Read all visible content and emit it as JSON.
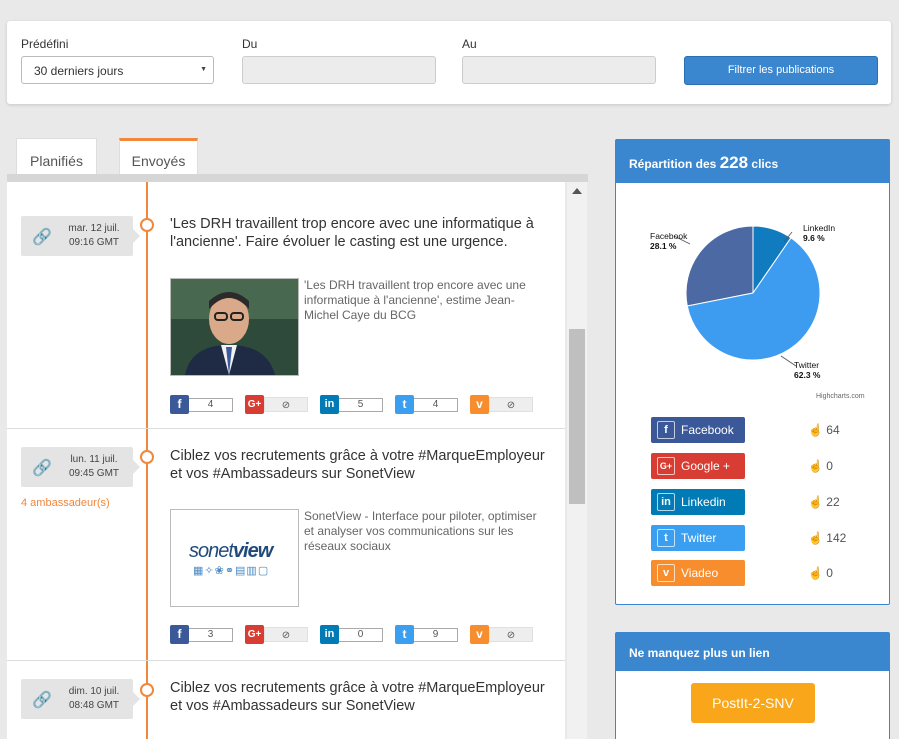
{
  "filter": {
    "predefini_label": "Prédéfini",
    "predefini_value": "30 derniers jours",
    "du_label": "Du",
    "au_label": "Au",
    "button_label": "Filtrer les publications"
  },
  "tabs": [
    {
      "label": "Planifiés",
      "active": false
    },
    {
      "label": "Envoyés",
      "active": true
    }
  ],
  "posts": [
    {
      "date": "mar. 12 juil.",
      "time": "09:16 GMT",
      "title": "'Les DRH travaillent trop encore avec une informatique à l'ancienne'. Faire évoluer le casting est une urgence.",
      "desc": "'Les DRH travaillent trop encore avec une informatique à l'ancienne', estime Jean-Michel Caye du BCG",
      "counts": {
        "facebook": "4",
        "google": "⊘",
        "linkedin": "5",
        "twitter": "4",
        "viadeo": "⊘"
      }
    },
    {
      "date": "lun. 11 juil.",
      "time": "09:45 GMT",
      "ambassadeurs": "4 ambassadeur(s)",
      "title": "Ciblez vos recrutements grâce à votre #MarqueEmployeur et vos #Ambassadeurs sur SonetView",
      "desc": "SonetView - Interface pour piloter, optimiser et analyser vos communications sur les réseaux sociaux",
      "thumb_logo_a": "sonet",
      "thumb_logo_b": "view",
      "counts": {
        "facebook": "3",
        "google": "⊘",
        "linkedin": "0",
        "twitter": "9",
        "viadeo": "⊘"
      }
    },
    {
      "date": "dim. 10 juil.",
      "time": "08:48 GMT",
      "title": "Ciblez vos recrutements grâce à votre #MarqueEmployeur et vos #Ambassadeurs sur SonetView"
    }
  ],
  "repartition": {
    "head_prefix": "Répartition des",
    "total": "228",
    "head_suffix": "clics",
    "pie": [
      {
        "name": "Facebook",
        "pct_label": "28.1 %",
        "value": 28.1,
        "color": "#4d69a3"
      },
      {
        "name": "LinkedIn",
        "pct_label": "9.6 %",
        "value": 9.6,
        "color": "#117bbf"
      },
      {
        "name": "Twitter",
        "pct_label": "62.3 %",
        "value": 62.3,
        "color": "#3d9cf0"
      }
    ],
    "credit": "Highcharts.com",
    "networks": [
      {
        "name": "Facebook",
        "icon": "f",
        "color": "#3b5998",
        "clicks": "64"
      },
      {
        "name": "Google +",
        "icon": "G+",
        "color": "#d73d32",
        "clicks": "0"
      },
      {
        "name": "Linkedin",
        "icon": "in",
        "color": "#007bb6",
        "clicks": "22"
      },
      {
        "name": "Twitter",
        "icon": "t",
        "color": "#3a9ff0",
        "clicks": "142"
      },
      {
        "name": "Viadeo",
        "icon": "v",
        "color": "#f88d2d",
        "clicks": "0"
      }
    ]
  },
  "lien": {
    "head": "Ne manquez plus un lien",
    "button": "PostIt-2-SNV"
  }
}
